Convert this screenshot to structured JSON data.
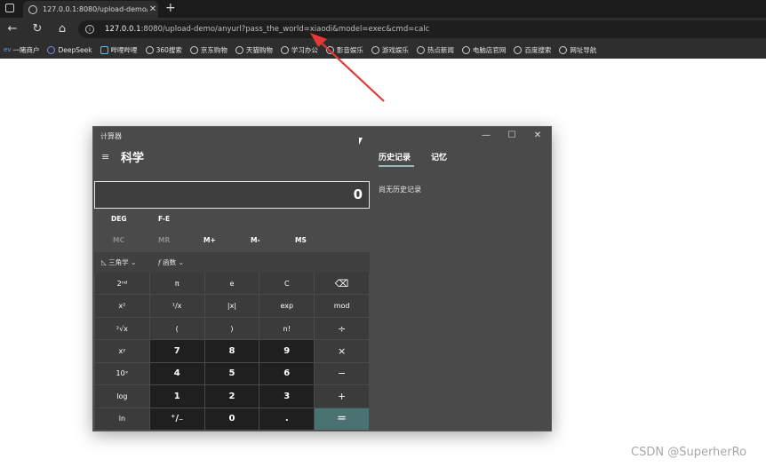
{
  "browser": {
    "tab": {
      "title": "127.0.0.1:8080/upload-demo/any",
      "close": "✕"
    },
    "new_tab": "+",
    "nav": {
      "back": "←",
      "reload": "↻",
      "home": "⌂"
    },
    "url": {
      "info": "i",
      "host": "127.0.0.1",
      "rest": ":8080/upload-demo/anyurl?pass_the_world=xiaodi&model=exec&cmd=calc"
    },
    "bookmarks": [
      "一睹商户",
      "DeepSeek",
      "哔哩哔哩",
      "360搜索",
      "京东购物",
      "天猫购物",
      "学习办公",
      "影音娱乐",
      "游戏娱乐",
      "热点新闻",
      "电脑店官网",
      "百度搜索",
      "网址导航"
    ],
    "bookmark_prefix": "ev"
  },
  "calculator": {
    "window_title": "计算器",
    "window_buttons": {
      "min": "—",
      "max": "☐",
      "close": "✕"
    },
    "menu": "≡",
    "mode": "科学",
    "display": "0",
    "angle_mode": "DEG",
    "fe": "F-E",
    "memory": [
      "MC",
      "MR",
      "M+",
      "M-",
      "MS"
    ],
    "func": {
      "trig": "三角学",
      "function": "函数",
      "trig_icon": "◺",
      "function_icon": "f",
      "chevron": "⌄"
    },
    "keys": [
      [
        "2ⁿᵈ",
        "π",
        "e",
        "C",
        "⌫"
      ],
      [
        "x²",
        "¹/x",
        "|x|",
        "exp",
        "mod"
      ],
      [
        "²√x",
        "(",
        ")",
        "n!",
        "÷"
      ],
      [
        "xʸ",
        "7",
        "8",
        "9",
        "×"
      ],
      [
        "10ˣ",
        "4",
        "5",
        "6",
        "−"
      ],
      [
        "log",
        "1",
        "2",
        "3",
        "+"
      ],
      [
        "ln",
        "⁺/₋",
        "0",
        ".",
        "="
      ]
    ],
    "history_tab": "历史记录",
    "memory_tab": "记忆",
    "history_empty": "尚无历史记录"
  },
  "watermark": "CSDN @SuperherRo",
  "colors": {
    "accent": "#4a7272",
    "arrow": "#e53935"
  }
}
